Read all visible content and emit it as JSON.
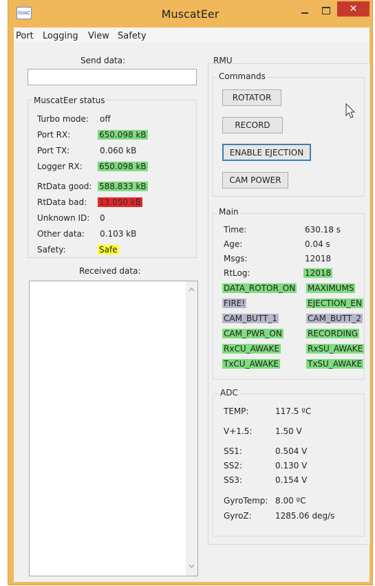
{
  "window": {
    "title": "MuscatEer",
    "app_icon": "ISIAC"
  },
  "menu": [
    "Port",
    "Logging",
    "View",
    "Safety"
  ],
  "send": {
    "label": "Send data:",
    "value": ""
  },
  "status": {
    "title": "MuscatEer status",
    "rows": [
      {
        "label": "Turbo mode:",
        "value": "off",
        "color": "none"
      },
      {
        "label": "Port RX:",
        "value": "650.098 kB",
        "color": "green"
      },
      {
        "label": "Port TX:",
        "value": "0.060 kB",
        "color": "none"
      },
      {
        "label": "Logger RX:",
        "value": "650.098 kB",
        "color": "green"
      },
      {
        "label": "RtData good:",
        "value": "588.833 kB",
        "color": "green"
      },
      {
        "label": "RtData bad:",
        "value": "13.050 kB",
        "color": "red"
      },
      {
        "label": "Unknown ID:",
        "value": "0",
        "color": "none"
      },
      {
        "label": "Other data:",
        "value": "0.103 kB",
        "color": "none"
      },
      {
        "label": "Safety:",
        "value": "Safe",
        "color": "yellow"
      }
    ]
  },
  "received": {
    "label": "Received data:"
  },
  "rmu": {
    "title": "RMU",
    "commands": {
      "title": "Commands",
      "buttons": [
        "ROTATOR",
        "RECORD",
        "ENABLE EJECTION",
        "CAM POWER"
      ]
    },
    "main": {
      "title": "Main",
      "rows": [
        {
          "label": "Time:",
          "value": "630.18 s",
          "color": "none"
        },
        {
          "label": "Age:",
          "value": "0.04 s",
          "color": "none"
        },
        {
          "label": "Msgs:",
          "value": "12018",
          "color": "none"
        },
        {
          "label": "RtLog:",
          "value": "12018",
          "color": "green"
        }
      ],
      "flags": [
        {
          "left": "DATA_ROTOR_ON",
          "left_color": "green",
          "right": "MAXIMUMS",
          "right_color": "green"
        },
        {
          "left": "FIRE!",
          "left_color": "lavender",
          "right": "EJECTION_EN",
          "right_color": "green"
        },
        {
          "left": "CAM_BUTT_1",
          "left_color": "lavender",
          "right": "CAM_BUTT_2",
          "right_color": "lavender"
        },
        {
          "left": "CAM_PWR_ON",
          "left_color": "green",
          "right": "RECORDING",
          "right_color": "green"
        },
        {
          "left": "RxCU_AWAKE",
          "left_color": "green",
          "right": "RxSU_AWAKE",
          "right_color": "green"
        },
        {
          "left": "TxCU_AWAKE",
          "left_color": "green",
          "right": "TxSU_AWAKE",
          "right_color": "green"
        }
      ]
    },
    "adc": {
      "title": "ADC",
      "rows": [
        {
          "label": "TEMP:",
          "value": "117.5 ºC"
        },
        {
          "label": "V+1.5:",
          "value": "1.50 V"
        },
        {
          "label": "SS1:",
          "value": "0.504 V"
        },
        {
          "label": "SS2:",
          "value": "0.130 V"
        },
        {
          "label": "SS3:",
          "value": "0.154 V"
        },
        {
          "label": "GyroTemp:",
          "value": "8.00 ºC"
        },
        {
          "label": "GyroZ:",
          "value": "1285.06 deg/s"
        }
      ]
    }
  },
  "colors": {
    "green": "#7fdc7f",
    "red": "#e6262a",
    "yellow": "#ffff33",
    "lavender": "#b8b8cc",
    "window_frame": "#f0b85a",
    "close": "#c7392b"
  }
}
